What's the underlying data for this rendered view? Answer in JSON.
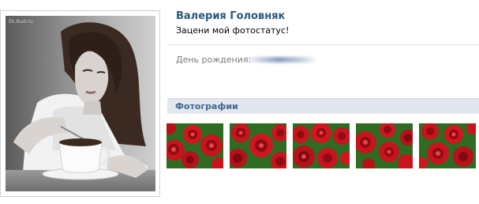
{
  "profile": {
    "name": "Валерия Головняк",
    "status": "Зацени мой фотостатус!"
  },
  "info": {
    "birthday_label": "День рождения:",
    "birthday_value_blurred": true
  },
  "avatar": {
    "watermark": "Ek.Bud.ru",
    "description": "girl with coffee cup"
  },
  "photos": {
    "header": "Фотографии",
    "thumbnails": [
      {
        "subject": "red roses"
      },
      {
        "subject": "red roses"
      },
      {
        "subject": "red roses"
      },
      {
        "subject": "red roses"
      },
      {
        "subject": "red roses"
      }
    ]
  },
  "colors": {
    "name": "#2b587a",
    "header_bg": "#e1e7ed",
    "header_text": "#45688e",
    "label": "#7a7a7a",
    "rose": "#c8141e"
  }
}
